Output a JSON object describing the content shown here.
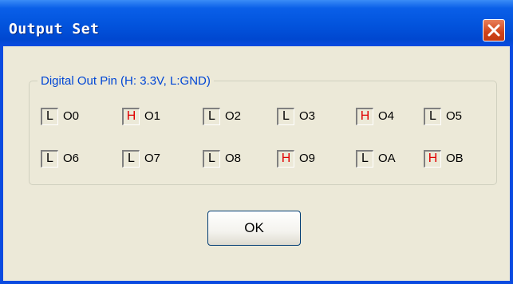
{
  "window": {
    "title": "Output Set"
  },
  "group": {
    "legend": "Digital Out Pin (H: 3.3V, L:GND)"
  },
  "pins": [
    {
      "state": "L",
      "name": "O0"
    },
    {
      "state": "H",
      "name": "O1"
    },
    {
      "state": "L",
      "name": "O2"
    },
    {
      "state": "L",
      "name": "O3"
    },
    {
      "state": "H",
      "name": "O4"
    },
    {
      "state": "L",
      "name": "O5"
    },
    {
      "state": "L",
      "name": "O6"
    },
    {
      "state": "L",
      "name": "O7"
    },
    {
      "state": "L",
      "name": "O8"
    },
    {
      "state": "H",
      "name": "O9"
    },
    {
      "state": "L",
      "name": "OA"
    },
    {
      "state": "H",
      "name": "OB"
    }
  ],
  "ok_button": {
    "label": "OK"
  },
  "colors": {
    "high_state": "#e00000",
    "legend_text": "#0046d5",
    "titlebar": "#0253dc"
  },
  "icons": {
    "close": "close-icon"
  }
}
